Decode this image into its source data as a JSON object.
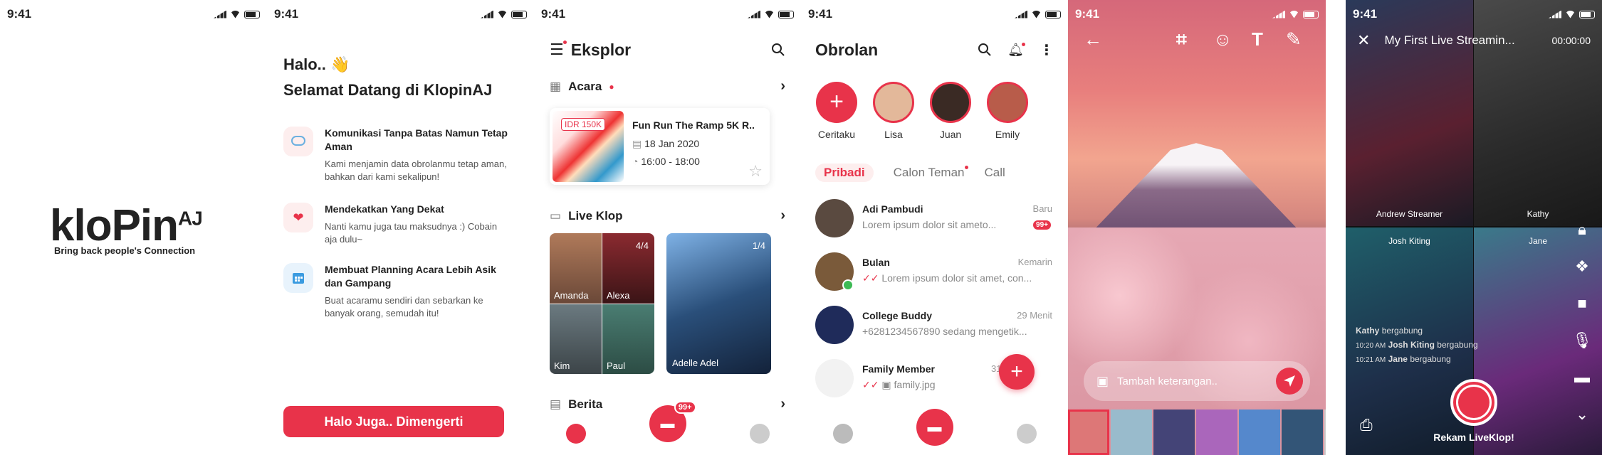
{
  "status": {
    "time": "9:41"
  },
  "splash": {
    "logo_main": "kloPin",
    "logo_suffix": "AJ",
    "tagline": "Bring back people's Connection"
  },
  "onboarding": {
    "greeting": "Halo.. 👋",
    "welcome": "Selamat Datang di KlopinAJ",
    "features": [
      {
        "icon": "chat-bubble-icon",
        "title": "Komunikasi Tanpa Batas Namun Tetap Aman",
        "desc": "Kami menjamin data obrolanmu tetap aman, bahkan dari kami sekalipun!"
      },
      {
        "icon": "heart-icon",
        "title": "Mendekatkan Yang Dekat",
        "desc": "Nanti kamu juga tau maksudnya :) Cobain aja dulu~"
      },
      {
        "icon": "calendar-icon",
        "title": "Membuat Planning Acara Lebih Asik dan Gampang",
        "desc": "Buat acaramu sendiri dan sebarkan ke banyak orang, semudah itu!"
      }
    ],
    "cta": "Halo Juga.. Dimengerti"
  },
  "explore": {
    "title": "Eksplor",
    "events_section": "Acara",
    "event": {
      "price": "IDR 150K",
      "title": "Fun Run The Ramp 5K R..",
      "date": "18 Jan 2020",
      "time": "16:00 - 18:00"
    },
    "liveklop_section": "Live Klop",
    "klop_groups": [
      {
        "count": "4/4",
        "members": [
          "Amanda",
          "Alexa",
          "Kim",
          "Paul"
        ]
      },
      {
        "count": "1/4",
        "members": [
          "Adelle Adel"
        ]
      }
    ],
    "news_section": "Berita",
    "chat_badge": "99+"
  },
  "chats": {
    "title": "Obrolan",
    "stories": [
      "Ceritaku",
      "Lisa",
      "Juan",
      "Emily"
    ],
    "tabs": [
      "Pribadi",
      "Calon Teman",
      "Call"
    ],
    "rows": [
      {
        "name": "Adi Pambudi",
        "msg": "Lorem ipsum dolor sit ameto...",
        "time": "Baru",
        "badge": "99+"
      },
      {
        "name": "Bulan",
        "msg": "Lorem ipsum dolor sit amet, con...",
        "time": "Kemarin"
      },
      {
        "name": "College Buddy",
        "msg": "+6281234567890 sedang mengetik...",
        "time": "29 Menit"
      },
      {
        "name": "Family Member",
        "msg": "family.jpg",
        "time": "31 A"
      }
    ]
  },
  "editor": {
    "caption_placeholder": "Tambah keterangan.."
  },
  "live": {
    "title": "My First Live Streamin...",
    "timer": "00:00:00",
    "participants": [
      "Andrew Streamer",
      "Kathy",
      "Josh Kiting",
      "Jane"
    ],
    "joins": [
      {
        "name": "Kathy",
        "text": "bergabung"
      },
      {
        "time": "10:20 AM",
        "name": "Josh Kiting",
        "text": "bergabung"
      },
      {
        "time": "10:21 AM",
        "name": "Jane",
        "text": "bergabung"
      }
    ],
    "record_label": "Rekam LiveKlop!"
  },
  "colors": {
    "accent": "#e8334a"
  }
}
